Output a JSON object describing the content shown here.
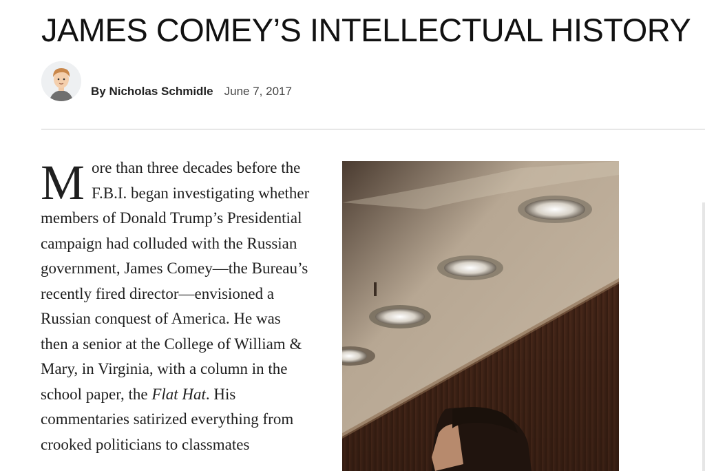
{
  "article": {
    "headline": "JAMES COMEY’S INTELLECTUAL HISTORY",
    "byline": {
      "author": "By Nicholas Schmidle",
      "date": "June 7, 2017"
    },
    "body": {
      "dropcap": "M",
      "before_italic": "ore than three decades before the F.B.I. began investigating whether members of Donald Trump’s Presidential campaign had colluded with the Russian government, James Comey—the Bureau’s recently fired director—envisioned a Russian conquest of America. He was then a senior at the College of William & Mary, in Virginia, with a column in the school paper, the ",
      "italic": "Flat Hat",
      "after_italic": ". His commentaries satirized everything from crooked politicians to classmates"
    }
  }
}
